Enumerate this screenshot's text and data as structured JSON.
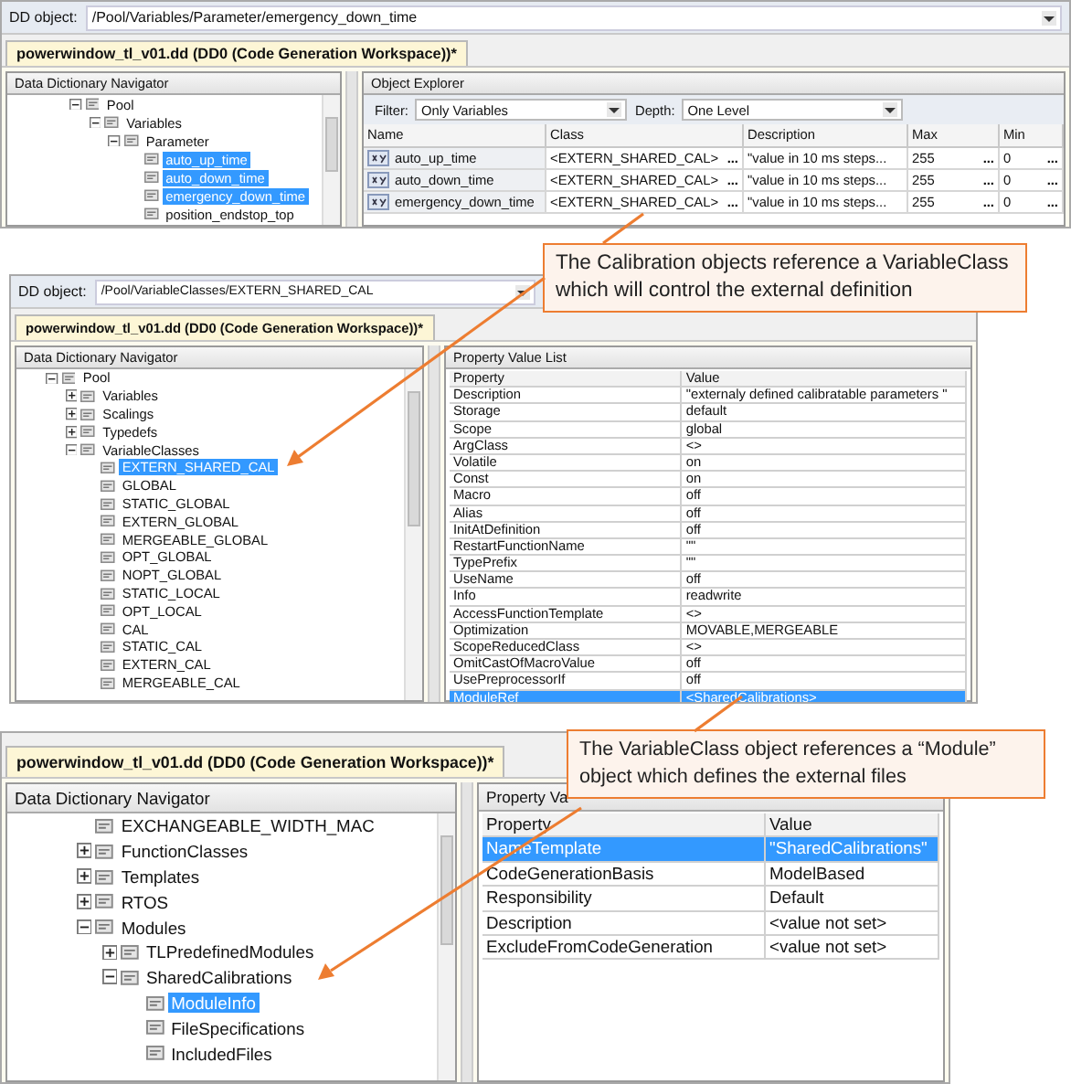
{
  "panels": [
    {
      "dd_object": {
        "label": "DD object:",
        "path": "/Pool/Variables/Parameter/emergency_down_time"
      },
      "document_tab": {
        "label": "powerwindow_tl_v01.dd (DD0 (Code Generation Workspace))*",
        "selected": true
      },
      "navigator": {
        "title": "Data Dictionary Navigator",
        "tree": [
          {
            "label": "Pool",
            "expanded": true,
            "selected": false,
            "children": [
              {
                "label": "Variables",
                "expanded": true,
                "selected": false,
                "children": [
                  {
                    "label": "Parameter",
                    "expanded": true,
                    "selected": false,
                    "children": [
                      {
                        "label": "auto_up_time",
                        "selected": true
                      },
                      {
                        "label": "auto_down_time",
                        "selected": true
                      },
                      {
                        "label": "emergency_down_time",
                        "selected": true
                      },
                      {
                        "label": "position_endstop_top",
                        "selected": false
                      }
                    ]
                  }
                ]
              }
            ]
          }
        ]
      },
      "object_explorer": {
        "title": "Object Explorer",
        "filter_label": "Filter:",
        "filter_value": "Only Variables",
        "depth_label": "Depth:",
        "depth_value": "One Level",
        "columns": [
          "Name",
          "Class",
          "Description",
          "Max",
          "Min"
        ],
        "rows": [
          {
            "cells": [
              {
                "text": "auto_up_time"
              },
              {
                "text": "<EXTERN_SHARED_CAL>",
                "button": "..."
              },
              {
                "text": "\"value in 10 ms steps..."
              },
              {
                "text": "255",
                "button": "..."
              },
              {
                "text": "0",
                "button": "..."
              }
            ]
          },
          {
            "cells": [
              {
                "text": "auto_down_time"
              },
              {
                "text": "<EXTERN_SHARED_CAL>",
                "button": "..."
              },
              {
                "text": "\"value in 10 ms steps..."
              },
              {
                "text": "255",
                "button": "..."
              },
              {
                "text": "0",
                "button": "..."
              }
            ]
          },
          {
            "cells": [
              {
                "text": "emergency_down_time"
              },
              {
                "text": "<EXTERN_SHARED_CAL>",
                "button": "..."
              },
              {
                "text": "\"value in 10 ms steps..."
              },
              {
                "text": "255",
                "button": "..."
              },
              {
                "text": "0",
                "button": "..."
              }
            ]
          }
        ]
      }
    },
    {
      "dd_object": {
        "label": "DD object:",
        "path": "/Pool/VariableClasses/EXTERN_SHARED_CAL"
      },
      "document_tab": {
        "label": "powerwindow_tl_v01.dd (DD0 (Code Generation Workspace))*",
        "selected": true
      },
      "navigator": {
        "title": "Data Dictionary Navigator",
        "tree": [
          {
            "label": "Pool",
            "expanded": true,
            "selected": false,
            "children": [
              {
                "label": "Variables",
                "expanded": false,
                "selected": false
              },
              {
                "label": "Scalings",
                "expanded": false,
                "selected": false
              },
              {
                "label": "Typedefs",
                "expanded": false,
                "selected": false
              },
              {
                "label": "VariableClasses",
                "expanded": true,
                "selected": false,
                "children": [
                  {
                    "label": "EXTERN_SHARED_CAL",
                    "selected": true
                  },
                  {
                    "label": "GLOBAL",
                    "selected": false
                  },
                  {
                    "label": "STATIC_GLOBAL",
                    "selected": false
                  },
                  {
                    "label": "EXTERN_GLOBAL",
                    "selected": false
                  },
                  {
                    "label": "MERGEABLE_GLOBAL",
                    "selected": false
                  },
                  {
                    "label": "OPT_GLOBAL",
                    "selected": false
                  },
                  {
                    "label": "NOPT_GLOBAL",
                    "selected": false
                  },
                  {
                    "label": "STATIC_LOCAL",
                    "selected": false
                  },
                  {
                    "label": "OPT_LOCAL",
                    "selected": false
                  },
                  {
                    "label": "CAL",
                    "selected": false
                  },
                  {
                    "label": "STATIC_CAL",
                    "selected": false
                  },
                  {
                    "label": "EXTERN_CAL",
                    "selected": false
                  },
                  {
                    "label": "MERGEABLE_CAL",
                    "selected": false
                  }
                ]
              }
            ]
          }
        ]
      },
      "property_list": {
        "title": "Property Value List",
        "columns": [
          "Property",
          "Value"
        ],
        "rows": [
          {
            "property": "Description",
            "value": "\"externaly defined calibratable parameters \"",
            "selected": false
          },
          {
            "property": "Storage",
            "value": "default",
            "selected": false
          },
          {
            "property": "Scope",
            "value": "global",
            "selected": false
          },
          {
            "property": "ArgClass",
            "value": "<>",
            "selected": false
          },
          {
            "property": "Volatile",
            "value": "on",
            "selected": false
          },
          {
            "property": "Const",
            "value": "on",
            "selected": false
          },
          {
            "property": "Macro",
            "value": "off",
            "selected": false
          },
          {
            "property": "Alias",
            "value": "off",
            "selected": false
          },
          {
            "property": "InitAtDefinition",
            "value": "off",
            "selected": false
          },
          {
            "property": "RestartFunctionName",
            "value": "\"\"",
            "selected": false
          },
          {
            "property": "TypePrefix",
            "value": "\"\"",
            "selected": false
          },
          {
            "property": "UseName",
            "value": "off",
            "selected": false
          },
          {
            "property": "Info",
            "value": "readwrite",
            "selected": false
          },
          {
            "property": "AccessFunctionTemplate",
            "value": "<>",
            "selected": false
          },
          {
            "property": "Optimization",
            "value": "MOVABLE,MERGEABLE",
            "selected": false
          },
          {
            "property": "ScopeReducedClass",
            "value": "<>",
            "selected": false
          },
          {
            "property": "OmitCastOfMacroValue",
            "value": "off",
            "selected": false
          },
          {
            "property": "UsePreprocessorIf",
            "value": "off",
            "selected": false
          },
          {
            "property": "ModuleRef",
            "value": "<SharedCalibrations>",
            "selected": true
          }
        ]
      }
    },
    {
      "document_tab": {
        "label": "powerwindow_tl_v01.dd (DD0 (Code Generation Workspace))*",
        "selected": true
      },
      "navigator": {
        "title": "Data Dictionary Navigator",
        "tree": [
          {
            "label": "EXCHANGEABLE_WIDTH_MAC",
            "selected": false
          },
          {
            "label": "FunctionClasses",
            "expanded": false,
            "selected": false
          },
          {
            "label": "Templates",
            "expanded": false,
            "selected": false
          },
          {
            "label": "RTOS",
            "expanded": false,
            "selected": false
          },
          {
            "label": "Modules",
            "expanded": true,
            "selected": false,
            "children": [
              {
                "label": "TLPredefinedModules",
                "expanded": false,
                "selected": false
              },
              {
                "label": "SharedCalibrations",
                "expanded": true,
                "selected": false,
                "children": [
                  {
                    "label": "ModuleInfo",
                    "selected": true
                  },
                  {
                    "label": "FileSpecifications",
                    "selected": false
                  },
                  {
                    "label": "IncludedFiles",
                    "selected": false
                  }
                ]
              }
            ]
          }
        ]
      },
      "property_list": {
        "title": "Property Va",
        "columns": [
          "Property",
          "Value"
        ],
        "rows": [
          {
            "property": "NameTemplate",
            "value": "\"SharedCalibrations\"",
            "selected": true
          },
          {
            "property": "CodeGenerationBasis",
            "value": "ModelBased",
            "selected": false
          },
          {
            "property": "Responsibility",
            "value": "Default",
            "selected": false
          },
          {
            "property": "Description",
            "value": "<value not set>",
            "selected": false
          },
          {
            "property": "ExcludeFromCodeGeneration",
            "value": "<value not set>",
            "selected": false
          }
        ]
      }
    }
  ],
  "callouts": [
    {
      "text": "The Calibration objects reference a VariableClass which will control the external definition"
    },
    {
      "text": "The VariableClass object references a “Module” object which defines the external files"
    }
  ]
}
